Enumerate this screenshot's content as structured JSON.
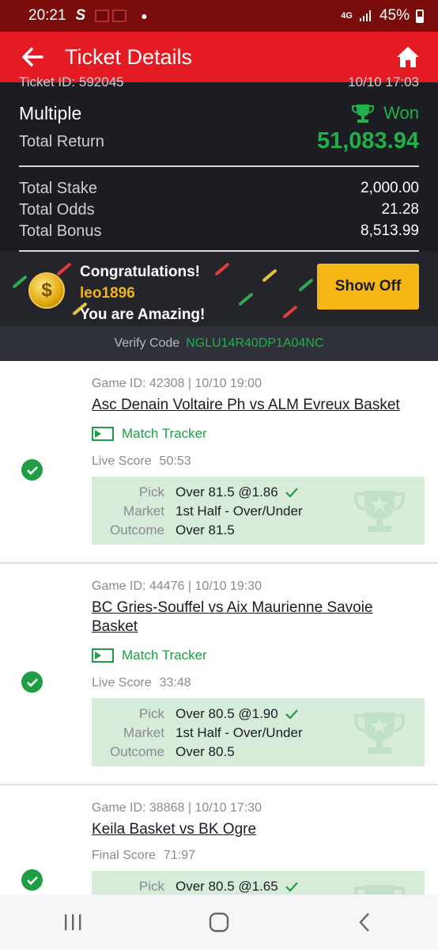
{
  "status_bar": {
    "time": "20:21",
    "network": "4G",
    "battery": "45%"
  },
  "header": {
    "title": "Ticket Details"
  },
  "summary": {
    "ticket_id": "Ticket ID: 592045",
    "ticket_time": "10/10 17:03",
    "bet_type": "Multiple",
    "status": "Won",
    "total_return_label": "Total Return",
    "total_return_value": "51,083.94",
    "rows": [
      {
        "label": "Total Stake",
        "value": "2,000.00"
      },
      {
        "label": "Total Odds",
        "value": "21.28"
      },
      {
        "label": "Total Bonus",
        "value": "8,513.99"
      }
    ]
  },
  "congrats": {
    "line1": "Congratulations!",
    "username": "leo1896",
    "line3": "You are Amazing!",
    "button": "Show Off"
  },
  "verify": {
    "label": "Verify Code",
    "code": "NGLU14R40DP1A04NC"
  },
  "games": [
    {
      "id_line": "Game ID: 42308 | 10/10 19:00",
      "match": "Asc Denain Voltaire Ph vs ALM Evreux Basket",
      "tracker": "Match Tracker",
      "score_label": "Live Score",
      "score": "50:53",
      "pick_label": "Pick",
      "pick": "Over 81.5 @1.86",
      "market_label": "Market",
      "market": "1st Half - Over/Under",
      "outcome_label": "Outcome",
      "outcome": "Over 81.5"
    },
    {
      "id_line": "Game ID: 44476 | 10/10 19:30",
      "match": "BC Gries-Souffel vs Aix Maurienne Savoie Basket",
      "tracker": "Match Tracker",
      "score_label": "Live Score",
      "score": "33:48",
      "pick_label": "Pick",
      "pick": "Over 80.5 @1.90",
      "market_label": "Market",
      "market": "1st Half - Over/Under",
      "outcome_label": "Outcome",
      "outcome": "Over 80.5"
    },
    {
      "id_line": "Game ID: 38868 | 10/10 17:30",
      "match": "Keila Basket vs BK Ogre",
      "score_label": "Final Score",
      "score": "71:97",
      "pick_label": "Pick",
      "pick": "Over 80.5 @1.65"
    }
  ],
  "colors": {
    "brand_red": "#e41b23",
    "win_green": "#1fb04a",
    "accent_yellow": "#f7b516"
  }
}
